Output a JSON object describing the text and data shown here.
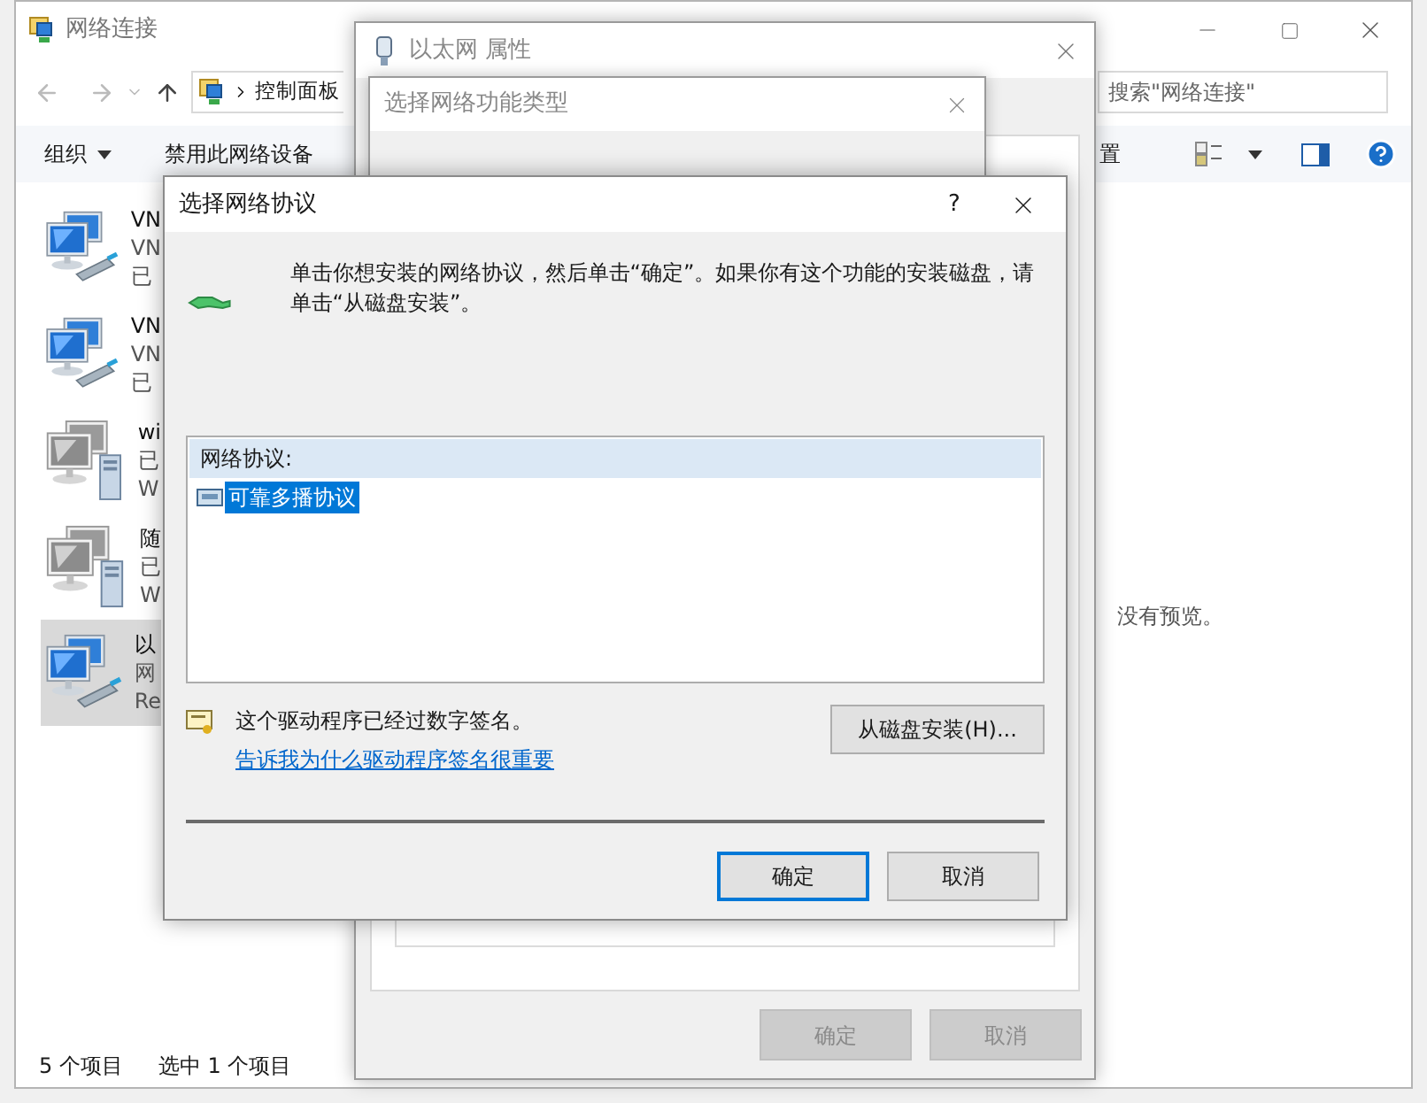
{
  "explorer": {
    "title": "网络连接",
    "address": "控制面板",
    "search": {
      "placeholder": "搜索\"网络连接\""
    },
    "toolbar": [
      {
        "label": "组织",
        "kind": "menu"
      },
      {
        "label": "禁用此网络设备",
        "kind": "button"
      },
      {
        "label": "置",
        "kind": "button"
      }
    ],
    "items": [
      {
        "kind": "wired",
        "selected": false,
        "lines": [
          "VN",
          "VN",
          "已"
        ]
      },
      {
        "kind": "wired",
        "selected": false,
        "lines": [
          "VN",
          "VN",
          "已"
        ]
      },
      {
        "kind": "server",
        "selected": false,
        "lines": [
          "wi",
          "已",
          "W"
        ]
      },
      {
        "kind": "server",
        "selected": false,
        "lines": [
          "随",
          "已",
          "W"
        ]
      },
      {
        "kind": "wired",
        "selected": true,
        "lines": [
          "以",
          "网",
          "Re"
        ]
      }
    ],
    "preview": "没有预览。",
    "status_bar": [
      "5 个项目",
      "选中 1 个项目"
    ]
  },
  "properties_window": {
    "title": "以太网 属性",
    "buttons": [
      {
        "label": "确定",
        "disabled": true
      },
      {
        "label": "取消",
        "disabled": true
      }
    ]
  },
  "feature_type_window": {
    "title": "选择网络功能类型"
  },
  "dialog": {
    "title": "选择网络协议",
    "help": "?",
    "instruction": "单击你想安装的网络协议，然后单击“确定”。如果你有这个功能的安装磁盘，请单击“从磁盘安装”。",
    "list": {
      "header": "网络协议:",
      "items": [
        {
          "label": "可靠多播协议",
          "selected": true
        }
      ]
    },
    "signed_note": "这个驱动程序已经过数字签名。",
    "link": "告诉我为什么驱动程序签名很重要",
    "disk_button": "从磁盘安装(H)...",
    "buttons": [
      {
        "label": "确定",
        "default": true
      },
      {
        "label": "取消",
        "default": false
      }
    ]
  }
}
